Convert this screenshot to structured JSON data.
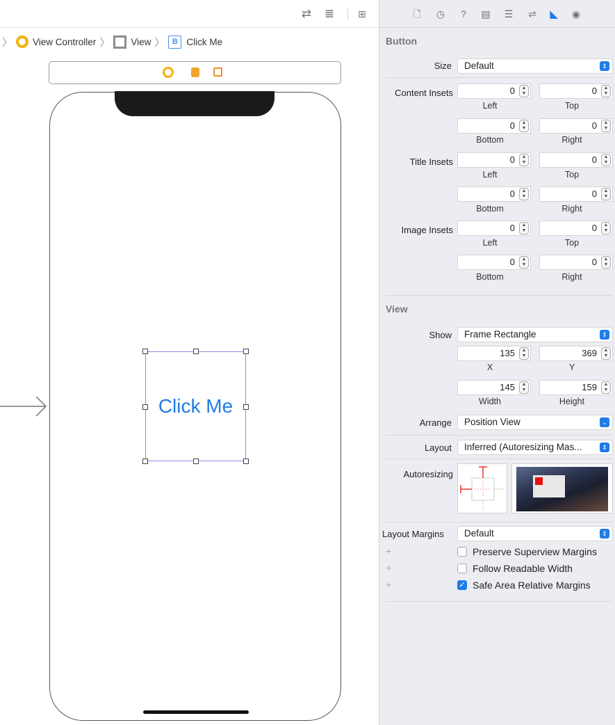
{
  "toolbar": {
    "icons": [
      "swap-arrows-icon",
      "lines-align-icon",
      "add-editor-icon"
    ]
  },
  "breadcrumb": {
    "items": [
      "View Controller",
      "View",
      "Click Me"
    ],
    "button_badge": "B"
  },
  "canvas": {
    "button_title": "Click Me",
    "button_color": "#1f7ce8",
    "selection_color": "#8a8ae6"
  },
  "inspector": {
    "tabs": [
      "file-icon",
      "history-icon",
      "help-icon",
      "identity-icon",
      "attributes-icon",
      "size-icon",
      "connections-icon"
    ],
    "active_tab": "size-icon",
    "button_section": {
      "title": "Button",
      "size_label": "Size",
      "size_value": "Default",
      "content_insets_label": "Content Insets",
      "content_insets": {
        "left": "0",
        "top": "0",
        "bottom": "0",
        "right": "0"
      },
      "title_insets_label": "Title Insets",
      "title_insets": {
        "left": "0",
        "top": "0",
        "bottom": "0",
        "right": "0"
      },
      "image_insets_label": "Image Insets",
      "image_insets": {
        "left": "0",
        "top": "0",
        "bottom": "0",
        "right": "0"
      },
      "sub_labels": {
        "left": "Left",
        "top": "Top",
        "bottom": "Bottom",
        "right": "Right"
      }
    },
    "view_section": {
      "title": "View",
      "show_label": "Show",
      "show_value": "Frame Rectangle",
      "x": "135",
      "y": "369",
      "width": "145",
      "height": "159",
      "x_label": "X",
      "y_label": "Y",
      "width_label": "Width",
      "height_label": "Height",
      "arrange_label": "Arrange",
      "arrange_value": "Position View",
      "layout_label": "Layout",
      "layout_value": "Inferred (Autoresizing Mas...",
      "autoresizing_label": "Autoresizing",
      "layout_margins_label": "Layout Margins",
      "layout_margins_value": "Default",
      "checkboxes": [
        {
          "label": "Preserve Superview Margins",
          "checked": false
        },
        {
          "label": "Follow Readable Width",
          "checked": false
        },
        {
          "label": "Safe Area Relative Margins",
          "checked": true
        }
      ]
    },
    "accent_color": "#1f7ce8"
  }
}
